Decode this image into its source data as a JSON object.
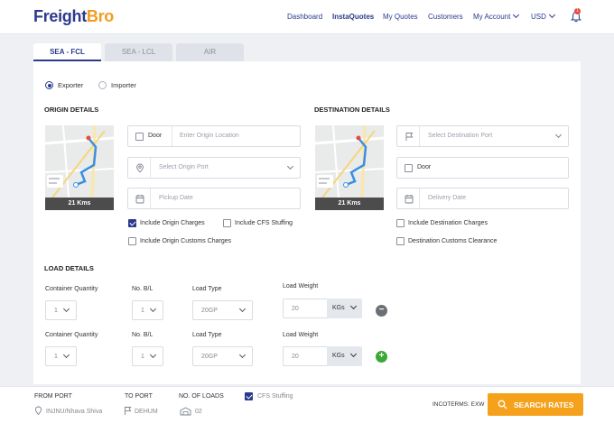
{
  "app": {
    "logo_part1": "Freight",
    "logo_part2": "Bro"
  },
  "nav": {
    "dashboard": "Dashboard",
    "instaquotes": "InstaQuotes",
    "my_quotes": "My Quotes",
    "customers": "Customers",
    "my_account": "My Account",
    "currency": "USD",
    "notification_count": "1"
  },
  "tabs": [
    "SEA - FCL",
    "SEA - LCL",
    "AIR"
  ],
  "role": {
    "exporter": "Exporter",
    "importer": "Importer",
    "selected": "Exporter"
  },
  "origin": {
    "title": "ORIGIN DETAILS",
    "map_distance": "21 Kms",
    "door_label": "Door",
    "location_placeholder": "Enter Origin Location",
    "port_placeholder": "Select Origin Port",
    "date_placeholder": "Pickup Date",
    "include_origin_charges": "Include Origin Charges",
    "include_cfs_stuffing": "Include CFS Stuffing",
    "include_origin_customs": "Include Origin Customs Charges"
  },
  "destination": {
    "title": "DESTINATION DETAILS",
    "map_distance": "21 Kms",
    "port_placeholder": "Select Destination Port",
    "door_label": "Door",
    "date_placeholder": "Delivery Date",
    "include_destination_charges": "Include Destination Charges",
    "destination_customs": "Destination Customs Clearance"
  },
  "load": {
    "title": "LOAD DETAILS",
    "headers": {
      "container_quantity": "Container Quantity",
      "no_bl": "No. B/L",
      "load_type": "Load Type",
      "load_weight": "Load Weight"
    },
    "rows": [
      {
        "quantity": "1",
        "bl": "1",
        "type": "20GP",
        "weight": "20",
        "unit": "KGs",
        "action": "−"
      },
      {
        "quantity": "1",
        "bl": "1",
        "type": "20GP",
        "weight": "20",
        "unit": "KGs",
        "action": "+"
      }
    ]
  },
  "footer": {
    "from_port_label": "FROM PORT",
    "from_port_value": "INJNU/Nhava Shiva",
    "to_port_label": "TO PORT",
    "to_port_value": "DEHUM",
    "loads_label": "NO. OF LOADS",
    "loads_value": "02",
    "cfs_stuffing": "CFS Stuffing",
    "incoterms": "INCOTERMS: EXW",
    "search_button": "SEARCH RATES"
  },
  "colors": {
    "brand_navy": "#2c3a8c",
    "brand_orange": "#f29b1f",
    "button_orange": "#f5a11b",
    "remove_gray": "#6c6f75",
    "add_green": "#3aaa35"
  }
}
